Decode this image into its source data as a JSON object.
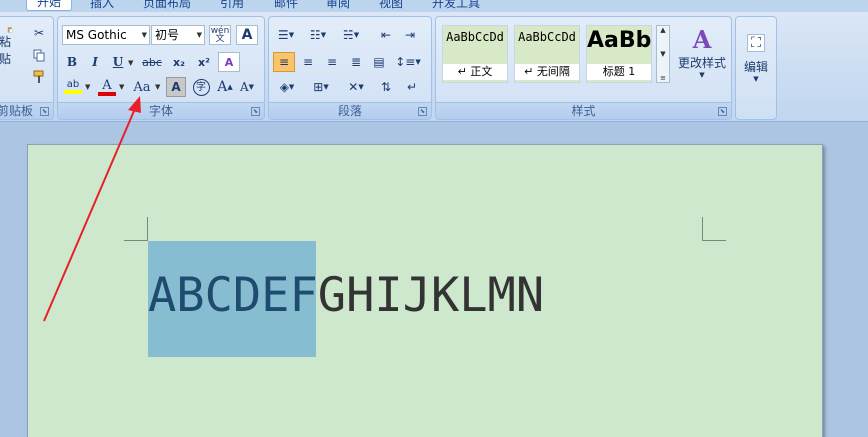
{
  "tabs": [
    {
      "label": "开始",
      "active": true
    },
    {
      "label": "插入"
    },
    {
      "label": "页面布局"
    },
    {
      "label": "引用"
    },
    {
      "label": "邮件"
    },
    {
      "label": "审阅"
    },
    {
      "label": "视图"
    },
    {
      "label": "开发工具"
    }
  ],
  "clipboard": {
    "paste_label": "粘贴",
    "group_label": "剪贴板"
  },
  "font": {
    "name": "MS Gothic",
    "size": "初号",
    "group_label": "字体",
    "phonetic_glyph": "wén 文",
    "border_glyph": "A",
    "bold": "B",
    "italic": "I",
    "underline": "U",
    "strike": "abc",
    "sub": "x₂",
    "sup": "x²",
    "clear": "A",
    "highlight": "ab",
    "color": "A",
    "case": "Aa",
    "shade": "A",
    "enclose": "字",
    "grow": "A",
    "shrink": "A"
  },
  "paragraph": {
    "group_label": "段落"
  },
  "styles": {
    "group_label": "样式",
    "items": [
      {
        "preview": "AaBbCcDd",
        "name": "↵ 正文"
      },
      {
        "preview": "AaBbCcDd",
        "name": "↵ 无间隔"
      },
      {
        "preview": "AaBb",
        "name": "标题 1"
      }
    ],
    "change_label": "更改样式"
  },
  "editing": {
    "label": "编辑"
  },
  "document": {
    "selected_text": "ABCDEF",
    "rest_text": "GHIJKLMN"
  },
  "colors": {
    "arrow": "#e8202a",
    "page": "#cde8cd",
    "selection": "#86bdd1",
    "font_color_bar": "#e00000",
    "highlight_bar": "#ffff00"
  }
}
